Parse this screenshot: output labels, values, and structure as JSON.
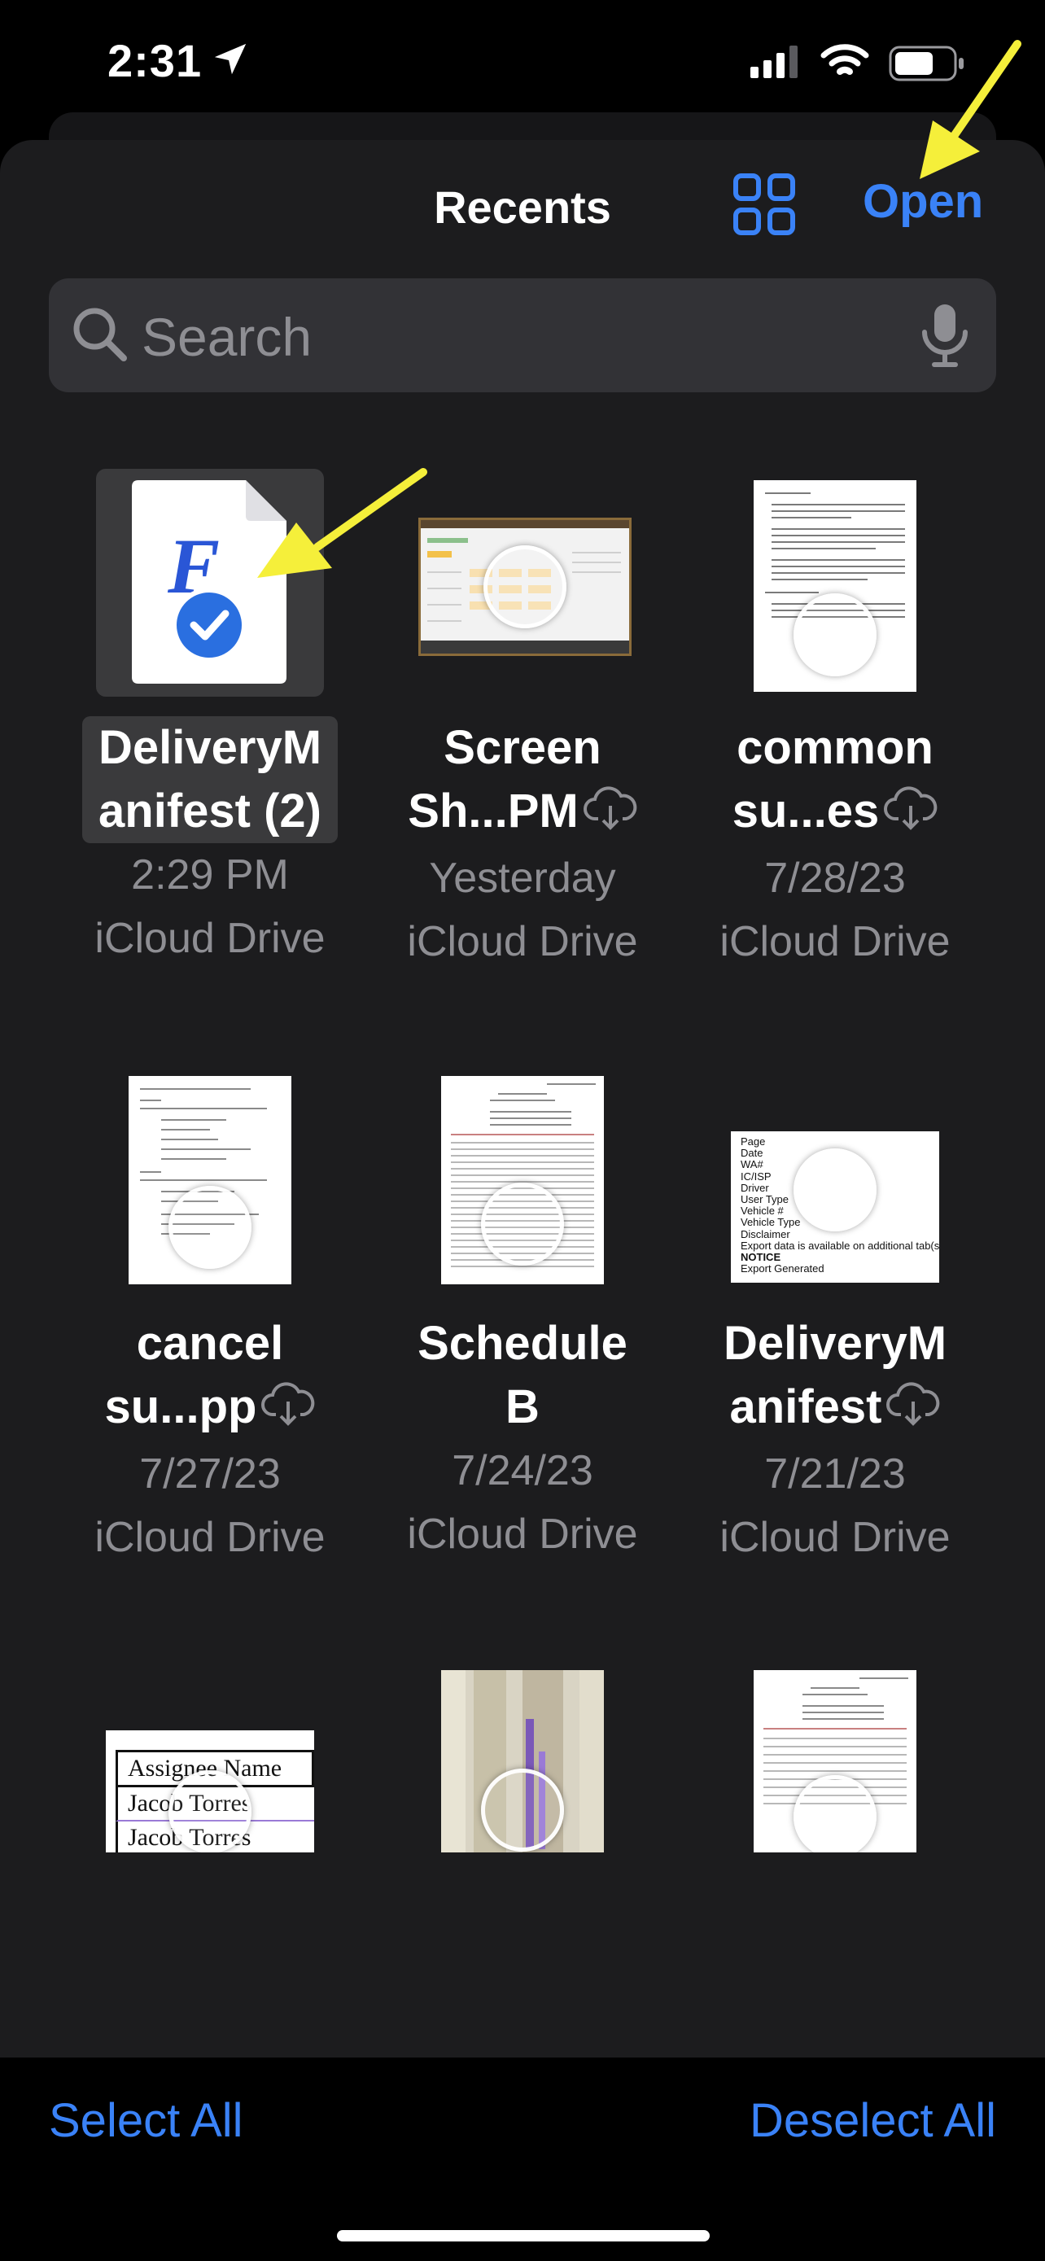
{
  "status_bar": {
    "time": "2:31"
  },
  "nav": {
    "title": "Recents",
    "open_label": "Open"
  },
  "search": {
    "placeholder": "Search"
  },
  "files": [
    {
      "name_line1": "DeliveryM",
      "name_line2": "anifest (2)",
      "date": "2:29 PM",
      "location": "iCloud Drive",
      "selected": true,
      "cloud": false,
      "thumb": "app-icon"
    },
    {
      "name_line1": "Screen",
      "name_line2": "Sh...PM",
      "date": "Yesterday",
      "location": "iCloud Drive",
      "selected": false,
      "cloud": true,
      "thumb": "screenshot"
    },
    {
      "name_line1": "common",
      "name_line2": "su...es",
      "date": "7/28/23",
      "location": "iCloud Drive",
      "selected": false,
      "cloud": true,
      "thumb": "document"
    },
    {
      "name_line1": "cancel",
      "name_line2": "su...pp",
      "date": "7/27/23",
      "location": "iCloud Drive",
      "selected": false,
      "cloud": true,
      "thumb": "document"
    },
    {
      "name_line1": "Schedule",
      "name_line2": "B",
      "date": "7/24/23",
      "location": "iCloud Drive",
      "selected": false,
      "cloud": false,
      "thumb": "document"
    },
    {
      "name_line1": "DeliveryM",
      "name_line2": "anifest",
      "date": "7/21/23",
      "location": "iCloud Drive",
      "selected": false,
      "cloud": true,
      "thumb": "manifest"
    }
  ],
  "manifest_thumb_lines": [
    "Page",
    "Date",
    "WA#",
    "IC/ISP",
    "Driver",
    "User Type",
    "Vehicle #",
    "Vehicle Type",
    "Disclaimer",
    "Export data is available on additional tab(s) in th",
    "NOTICE",
    "Export Generated"
  ],
  "partial_thumb_text": {
    "header": "Assignee Name",
    "row1": "Jacob Torres",
    "row2": "Jacob Torres"
  },
  "bottom_bar": {
    "select_all": "Select All",
    "deselect_all": "Deselect All"
  },
  "colors": {
    "accent": "#3a82f7",
    "sheet": "#1c1c1e",
    "annotation_arrow": "#f5ef3a"
  }
}
